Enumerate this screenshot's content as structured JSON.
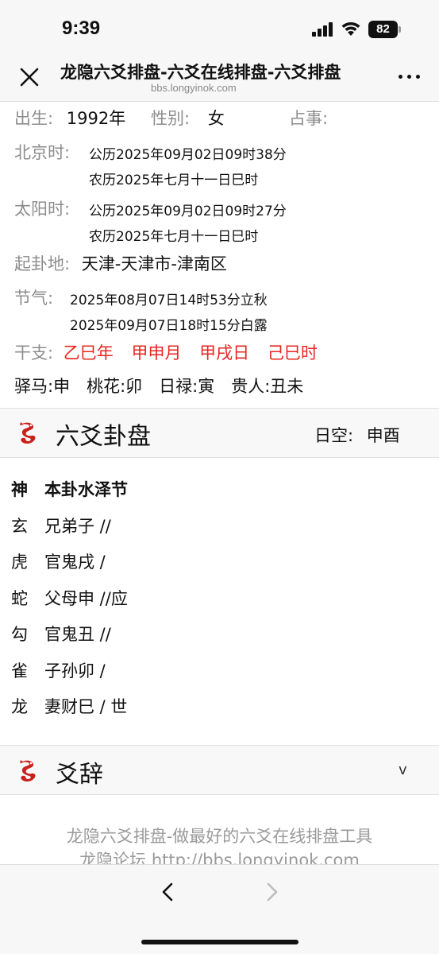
{
  "status_bar": {
    "time": "9:39",
    "battery": "82"
  },
  "browser": {
    "title": "龙隐六爻排盘-六爻在线排盘-六爻排盘",
    "url": "bbs.longyinok.com"
  },
  "info": {
    "birth_label": "出生:",
    "birth_value": "1992年",
    "gender_label": "性别:",
    "gender_value": "女",
    "matter_label": "占事:",
    "beijing_label": "北京时:",
    "beijing_solar": "公历2025年09月02日09时38分",
    "beijing_lunar": "农历2025年七月十一日巳时",
    "sun_label": "太阳时:",
    "sun_solar": "公历2025年09月02日09时27分",
    "sun_lunar": "农历2025年七月十一日巳时",
    "place_label": "起卦地:",
    "place_value": "天津-天津市-津南区",
    "jieqi_label": "节气:",
    "jieqi_1": "2025年08月07日14时53分立秋",
    "jieqi_2": "2025年09月07日18时15分白露",
    "ganzhi_label": "干支:",
    "ganzhi": [
      "乙巳年",
      "甲申月",
      "甲戌日",
      "己巳时"
    ],
    "extras": "驿马:申　桃花:卯　日禄:寅　贵人:丑未"
  },
  "pan": {
    "title": "六爻卦盘",
    "kong_label": "日空:",
    "kong_value": "申酉",
    "header_god": "神",
    "header_gua": "本卦水泽节",
    "lines": [
      {
        "god": "玄",
        "text": "兄弟子 //"
      },
      {
        "god": "虎",
        "text": "官鬼戌 /"
      },
      {
        "god": "蛇",
        "text": "父母申 //应"
      },
      {
        "god": "勾",
        "text": "官鬼丑 //"
      },
      {
        "god": "雀",
        "text": "子孙卯 /"
      },
      {
        "god": "龙",
        "text": "妻财巳 / 世"
      }
    ]
  },
  "yaoci": {
    "title": "爻辞",
    "toggle": "v"
  },
  "footer": {
    "line1": "龙隐六爻排盘-做最好的六爻在线排盘工具",
    "line2": "龙隐论坛 http://bbs.longyinok.com"
  },
  "colors": {
    "accent_red": "#e8261f",
    "label_gray": "#8d8d8d"
  },
  "icons": {
    "close": "close-icon",
    "more": "more-icon",
    "back": "back-icon",
    "forward": "forward-icon",
    "dragon": "dragon-logo-icon"
  }
}
